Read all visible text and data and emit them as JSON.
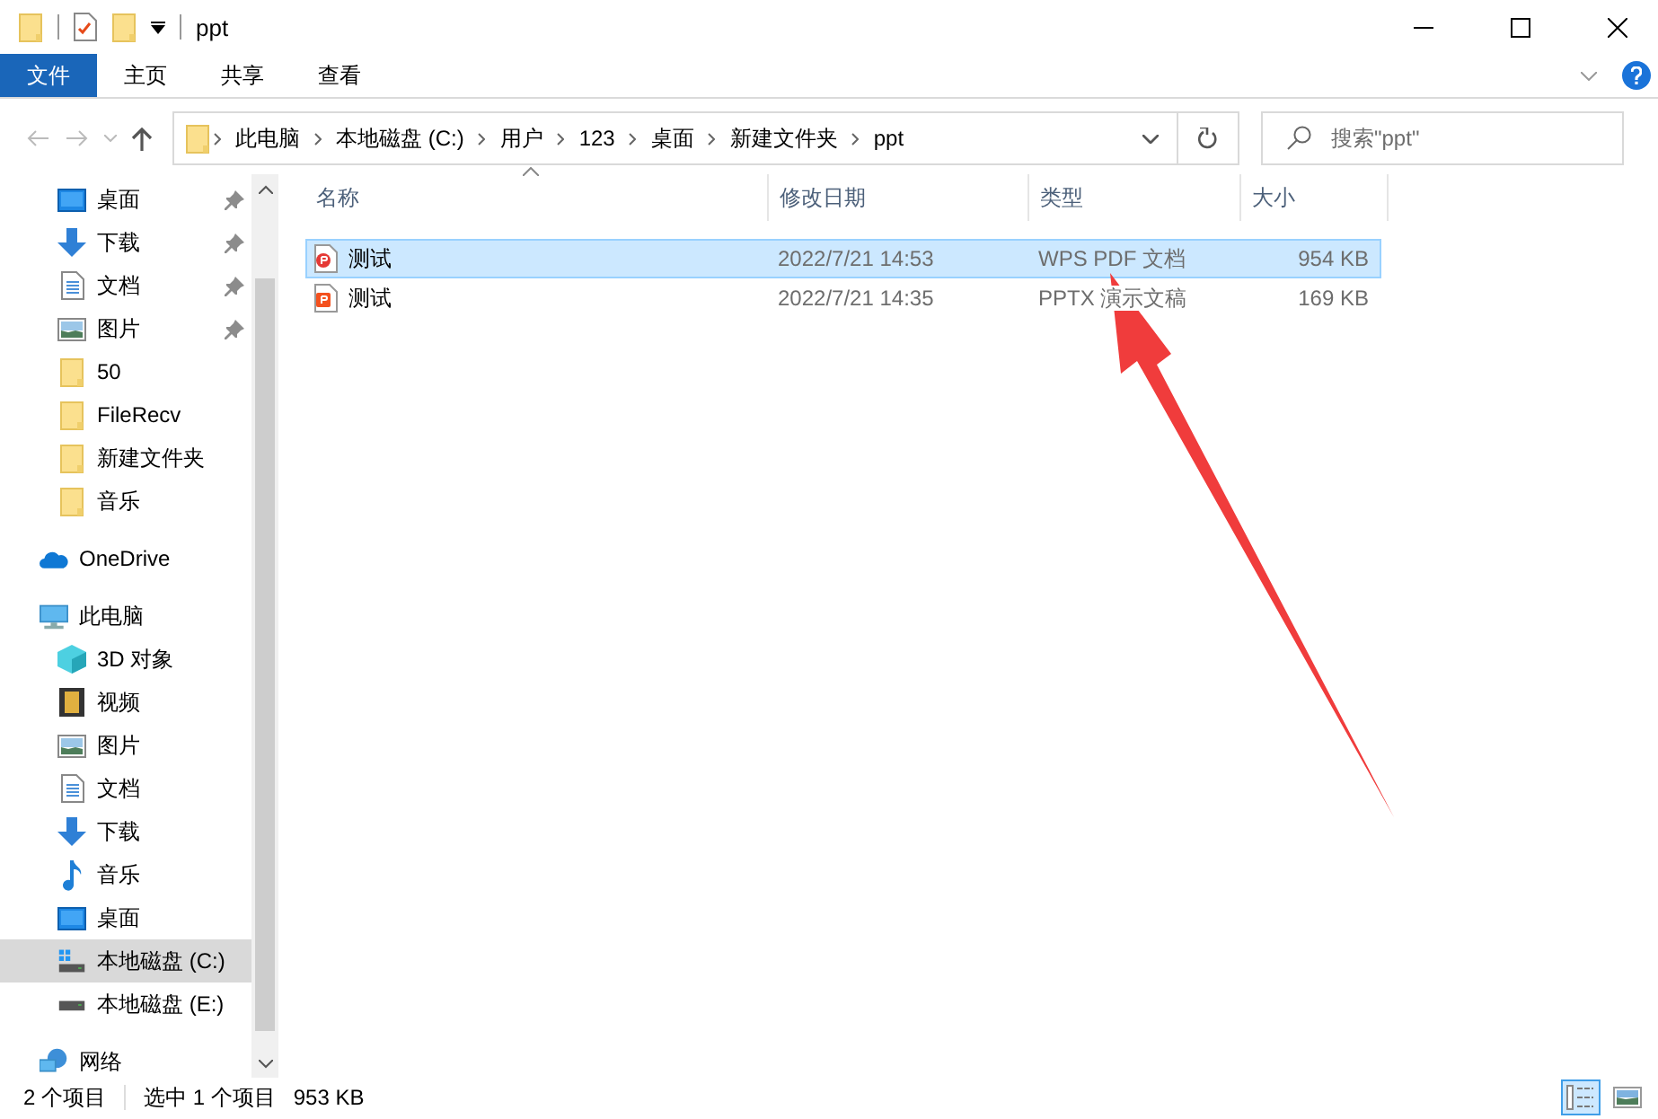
{
  "window": {
    "title": "ppt"
  },
  "ribbon_tabs": [
    {
      "label": "文件",
      "selected": true
    },
    {
      "label": "主页",
      "selected": false
    },
    {
      "label": "共享",
      "selected": false
    },
    {
      "label": "查看",
      "selected": false
    }
  ],
  "breadcrumb": [
    "此电脑",
    "本地磁盘 (C:)",
    "用户",
    "123",
    "桌面",
    "新建文件夹",
    "ppt"
  ],
  "search": {
    "placeholder": "搜索\"ppt\""
  },
  "quick_access": [
    {
      "label": "桌面",
      "kind": "desktop",
      "pinned": true,
      "selected": false
    },
    {
      "label": "下载",
      "kind": "download",
      "pinned": true,
      "selected": false
    },
    {
      "label": "文档",
      "kind": "document",
      "pinned": true,
      "selected": false
    },
    {
      "label": "图片",
      "kind": "picture",
      "pinned": true,
      "selected": false
    },
    {
      "label": "50",
      "kind": "folder",
      "pinned": false,
      "selected": false
    },
    {
      "label": "FileRecv",
      "kind": "folder",
      "pinned": false,
      "selected": false
    },
    {
      "label": "新建文件夹",
      "kind": "folder",
      "pinned": false,
      "selected": false
    },
    {
      "label": "音乐",
      "kind": "folder",
      "pinned": false,
      "selected": false
    }
  ],
  "nav": [
    {
      "label": "OneDrive",
      "kind": "cloud",
      "selected": false
    },
    {
      "label": "此电脑",
      "kind": "pc",
      "selected": false,
      "children": [
        {
          "label": "3D 对象",
          "kind": "cube",
          "selected": false
        },
        {
          "label": "视频",
          "kind": "video",
          "selected": false
        },
        {
          "label": "图片",
          "kind": "picture",
          "selected": false
        },
        {
          "label": "文档",
          "kind": "document",
          "selected": false
        },
        {
          "label": "下载",
          "kind": "download",
          "selected": false
        },
        {
          "label": "音乐",
          "kind": "music",
          "selected": false
        },
        {
          "label": "桌面",
          "kind": "desktop",
          "selected": false
        },
        {
          "label": "本地磁盘 (C:)",
          "kind": "drive-system",
          "selected": true
        },
        {
          "label": "本地磁盘 (E:)",
          "kind": "drive",
          "selected": false
        }
      ]
    },
    {
      "label": "网络",
      "kind": "network",
      "selected": false
    }
  ],
  "table": {
    "columns": [
      "名称",
      "修改日期",
      "类型",
      "大小"
    ],
    "rows": [
      {
        "name": "测试",
        "kind": "pdf",
        "modified": "2022/7/21 14:53",
        "type": "WPS PDF 文档",
        "size": "954 KB",
        "selected": true
      },
      {
        "name": "测试",
        "kind": "ppt",
        "modified": "2022/7/21 14:35",
        "type": "PPTX 演示文稿",
        "size": "169 KB",
        "selected": false
      }
    ]
  },
  "status_bar": {
    "count": "2 个项目",
    "selection": "选中 1 个项目",
    "size": "953 KB",
    "views": [
      {
        "kind": "details",
        "selected": true
      },
      {
        "kind": "thumbnails",
        "selected": false
      }
    ]
  }
}
